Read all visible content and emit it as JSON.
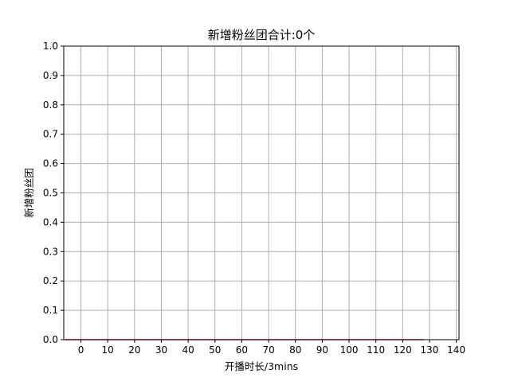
{
  "chart_data": {
    "type": "line",
    "title": "新增粉丝团合计:0个",
    "xlabel": "开播时长/3mins",
    "ylabel": "新增粉丝团",
    "xlim": [
      -6.4,
      141
    ],
    "ylim": [
      0,
      1.0
    ],
    "x_ticks": [
      "0",
      "10",
      "20",
      "30",
      "40",
      "50",
      "60",
      "70",
      "80",
      "90",
      "100",
      "110",
      "120",
      "130",
      "140"
    ],
    "y_ticks": [
      "0.0",
      "0.1",
      "0.2",
      "0.3",
      "0.4",
      "0.5",
      "0.6",
      "0.7",
      "0.8",
      "0.9",
      "1.0"
    ],
    "grid": true,
    "series": [
      {
        "color": "#d62728",
        "x": [
          -6,
          128
        ],
        "y": [
          0,
          0
        ]
      }
    ]
  }
}
